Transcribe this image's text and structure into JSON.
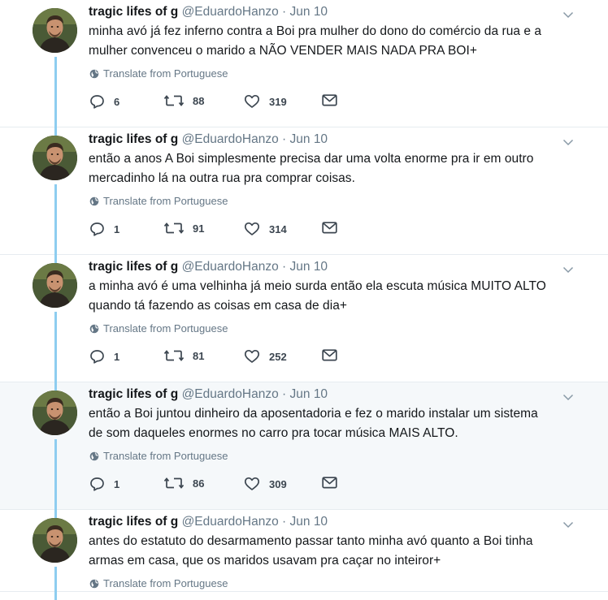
{
  "thread": {
    "tweets": [
      {
        "name": "tragic lifes of g",
        "handle": "@EduardoHanzo",
        "separator": "·",
        "date": "Jun 10",
        "lines": [
          "minha avó já fez inferno contra a Boi pra mulher do dono do comércio da rua e a",
          "mulher convenceu o marido a NÃO VENDER MAIS NADA PRA BOI+"
        ],
        "translate_label": "Translate from Portuguese",
        "replies": "6",
        "retweets": "88",
        "likes": "319"
      },
      {
        "name": "tragic lifes of g",
        "handle": "@EduardoHanzo",
        "separator": "·",
        "date": "Jun 10",
        "lines": [
          "então a anos A Boi simplesmente precisa dar uma volta enorme pra ir em outro",
          "mercadinho lá na outra rua pra comprar coisas."
        ],
        "translate_label": "Translate from Portuguese",
        "replies": "1",
        "retweets": "91",
        "likes": "314"
      },
      {
        "name": "tragic lifes of g",
        "handle": "@EduardoHanzo",
        "separator": "·",
        "date": "Jun 10",
        "lines": [
          "a minha avó é uma velhinha já meio surda então ela escuta música MUITO ALTO",
          "quando tá fazendo as coisas em casa de dia+"
        ],
        "translate_label": "Translate from Portuguese",
        "replies": "1",
        "retweets": "81",
        "likes": "252"
      },
      {
        "name": "tragic lifes of g",
        "handle": "@EduardoHanzo",
        "separator": "·",
        "date": "Jun 10",
        "lines": [
          "então a Boi juntou dinheiro da aposentadoria e fez o marido instalar um sistema",
          "de som daqueles enormes no carro pra tocar música MAIS ALTO."
        ],
        "translate_label": "Translate from Portuguese",
        "replies": "1",
        "retweets": "86",
        "likes": "309"
      },
      {
        "name": "tragic lifes of g",
        "handle": "@EduardoHanzo",
        "separator": "·",
        "date": "Jun 10",
        "lines": [
          "antes do estatuto do desarmamento passar tanto minha avó quanto a Boi tinha",
          "armas em casa, que os maridos usavam pra caçar no inteiror+"
        ],
        "translate_label": "Translate from Portuguese",
        "replies": "",
        "retweets": "",
        "likes": ""
      }
    ]
  },
  "colors": {
    "text": "#14171a",
    "muted": "#657786",
    "thread_line": "#8ecdf0",
    "highlight_bg": "#f5f8fa",
    "divider": "#e6ecf0"
  },
  "icons": {
    "reply": "reply-icon",
    "retweet": "retweet-icon",
    "like": "heart-icon",
    "dm": "envelope-icon",
    "translate": "globe-icon",
    "menu": "chevron-down-icon"
  }
}
